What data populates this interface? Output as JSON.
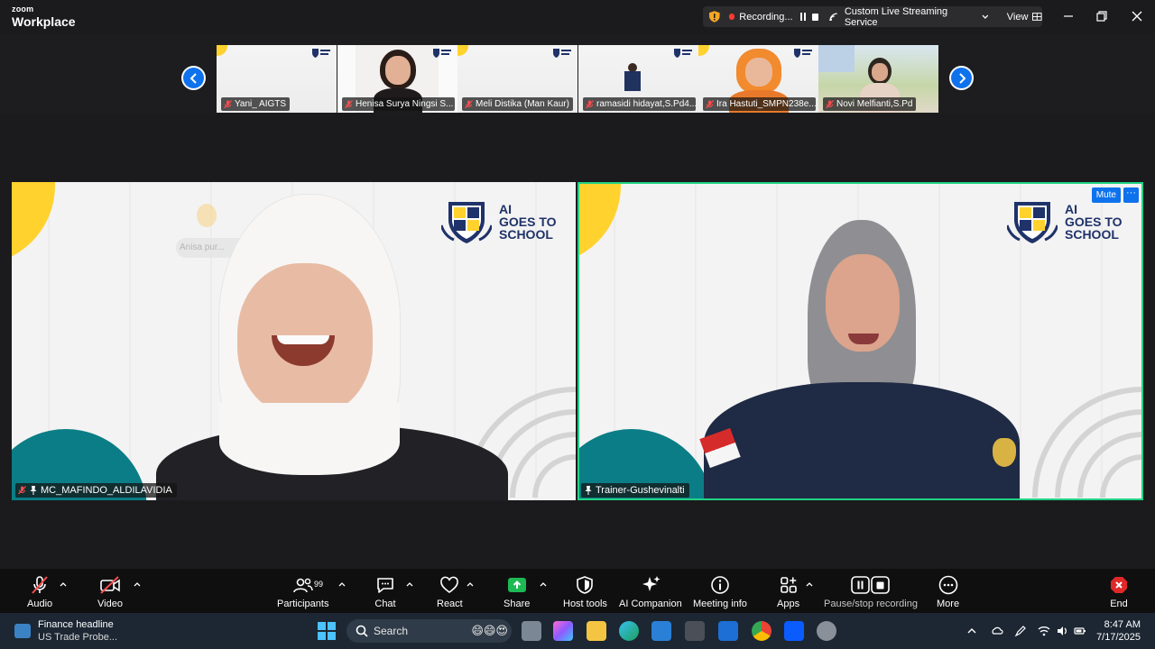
{
  "app": {
    "brand_small": "zoom",
    "brand_large": "Workplace"
  },
  "recording_bar": {
    "status": "Recording...",
    "stream_label": "Custom Live Streaming Service",
    "view_label": "View"
  },
  "thumbnails": [
    {
      "name": "Yani_ AIGTS"
    },
    {
      "name": "Henisa Surya Ningsi S..."
    },
    {
      "name": "Meli Distika (Man Kaur)"
    },
    {
      "name": "ramasidi hidayat,S.Pd4..."
    },
    {
      "name": "Ira Hastuti_SMPN238e..."
    },
    {
      "name": "Novi Melfianti,S.Pd"
    }
  ],
  "main_videos": {
    "left": {
      "name": "MC_MAFINDO_ALDILAVIDIA",
      "background_chip": "Anisa pur..."
    },
    "right": {
      "name": "Trainer-Gushevinalti",
      "mute_label": "Mute",
      "more_label": "···"
    },
    "logo_text": [
      "AI",
      "GOES TO",
      "SCHOOL"
    ]
  },
  "toolbar": {
    "participants_count": "99",
    "items": [
      {
        "label": "Audio"
      },
      {
        "label": "Video"
      },
      {
        "label": "Participants"
      },
      {
        "label": "Chat"
      },
      {
        "label": "React"
      },
      {
        "label": "Share"
      },
      {
        "label": "Host tools"
      },
      {
        "label": "AI Companion"
      },
      {
        "label": "Meeting info"
      },
      {
        "label": "Apps"
      },
      {
        "label": "Pause/stop recording"
      },
      {
        "label": "More"
      },
      {
        "label": "End"
      }
    ]
  },
  "taskbar": {
    "news_title": "Finance headline",
    "news_sub": "US Trade Probe...",
    "search_placeholder": "Search",
    "time": "8:47 AM",
    "date": "7/17/2025"
  },
  "colors": {
    "accent_blue": "#0e72ed",
    "active_speaker": "#21d384",
    "record_red": "#ff3b30",
    "share_green": "#1db954"
  }
}
